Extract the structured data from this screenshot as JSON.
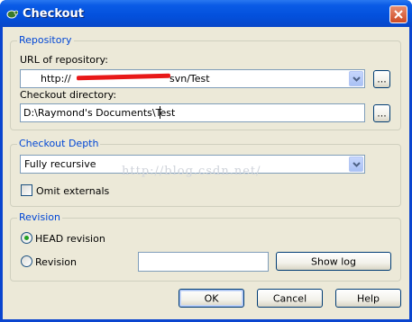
{
  "window": {
    "title": "Checkout",
    "icon": "tortoise-svn-icon",
    "close_icon": "close-icon"
  },
  "repository": {
    "legend": "Repository",
    "url_label": "URL of repository:",
    "url_prefix": "http://",
    "url_suffix": "svn/Test",
    "browse_label": "...",
    "dir_label": "Checkout directory:",
    "dir_value": "D:\\Raymond's Documents\\Test",
    "dir_browse_label": "..."
  },
  "depth": {
    "legend": "Checkout Depth",
    "selected": "Fully recursive",
    "omit_label": "Omit externals",
    "omit_checked": false
  },
  "revision": {
    "legend": "Revision",
    "head_label": "HEAD revision",
    "head_selected": true,
    "rev_label": "Revision",
    "rev_value": "",
    "showlog_label": "Show log"
  },
  "buttons": {
    "ok": "OK",
    "cancel": "Cancel",
    "help": "Help"
  },
  "watermark": "http://blog.csdn.net/",
  "colors": {
    "titlebar": "#0350dc",
    "group_legend": "#0046d5",
    "client_bg": "#ece9d8",
    "redaction": "#e81818"
  }
}
